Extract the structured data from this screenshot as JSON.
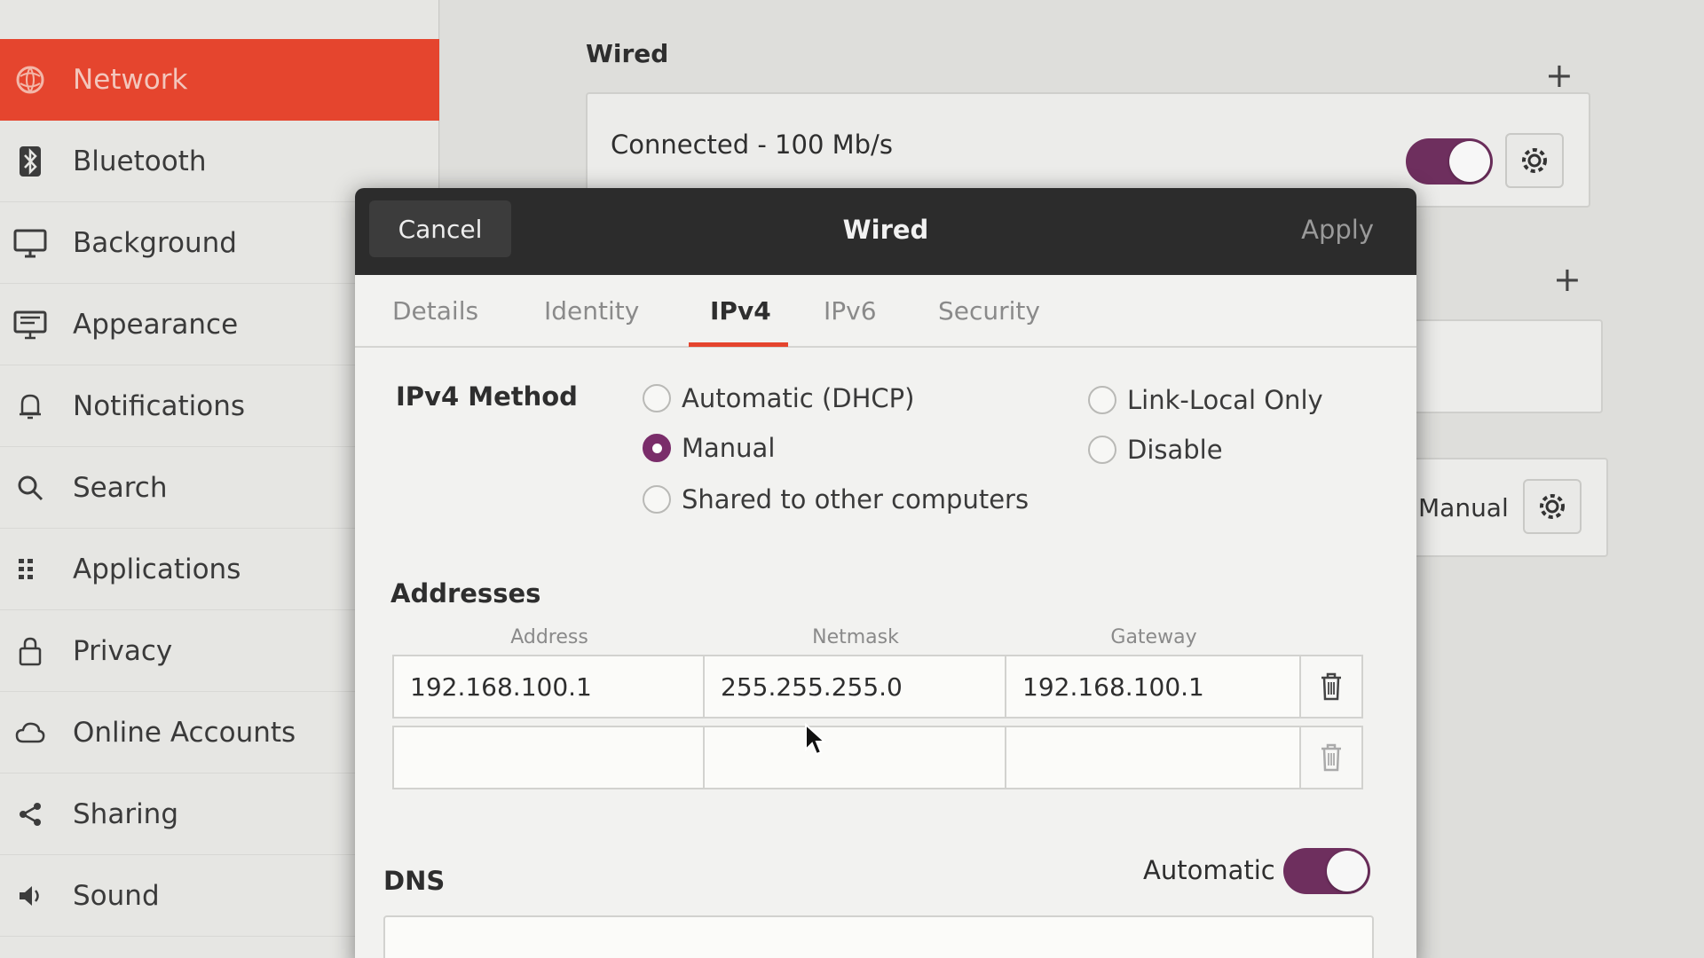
{
  "sidebar": {
    "items": [
      {
        "label": "Network",
        "icon": "network-icon",
        "active": true
      },
      {
        "label": "Bluetooth",
        "icon": "bluetooth-icon"
      },
      {
        "label": "Background",
        "icon": "monitor-icon"
      },
      {
        "label": "Appearance",
        "icon": "appearance-icon"
      },
      {
        "label": "Notifications",
        "icon": "bell-icon"
      },
      {
        "label": "Search",
        "icon": "search-icon"
      },
      {
        "label": "Applications",
        "icon": "grid-icon"
      },
      {
        "label": "Privacy",
        "icon": "lock-icon"
      },
      {
        "label": "Online Accounts",
        "icon": "cloud-icon"
      },
      {
        "label": "Sharing",
        "icon": "share-icon"
      },
      {
        "label": "Sound",
        "icon": "speaker-icon"
      }
    ]
  },
  "panel": {
    "wired_title": "Wired",
    "wired_status": "Connected - 100 Mb/s",
    "wired_enabled": true,
    "vpn_status": "Manual"
  },
  "dialog": {
    "title": "Wired",
    "cancel_label": "Cancel",
    "apply_label": "Apply",
    "tabs": [
      "Details",
      "Identity",
      "IPv4",
      "IPv6",
      "Security"
    ],
    "active_tab": "IPv4",
    "ipv4_method_label": "IPv4 Method",
    "methods": {
      "automatic": "Automatic (DHCP)",
      "manual": "Manual",
      "shared": "Shared to other computers",
      "link_local": "Link-Local Only",
      "disable": "Disable"
    },
    "selected_method": "Manual",
    "addresses_label": "Addresses",
    "columns": {
      "address": "Address",
      "netmask": "Netmask",
      "gateway": "Gateway"
    },
    "rows": [
      {
        "address": "192.168.100.1",
        "netmask": "255.255.255.0",
        "gateway": "192.168.100.1"
      },
      {
        "address": "",
        "netmask": "",
        "gateway": ""
      }
    ],
    "dns_label": "DNS",
    "dns_automatic_label": "Automatic",
    "dns_automatic": true
  },
  "colors": {
    "accent": "#e5452e",
    "toggle_on": "#6e2f5e",
    "radio_checked": "#7a2d6a",
    "header_bg": "#2c2c2c"
  }
}
